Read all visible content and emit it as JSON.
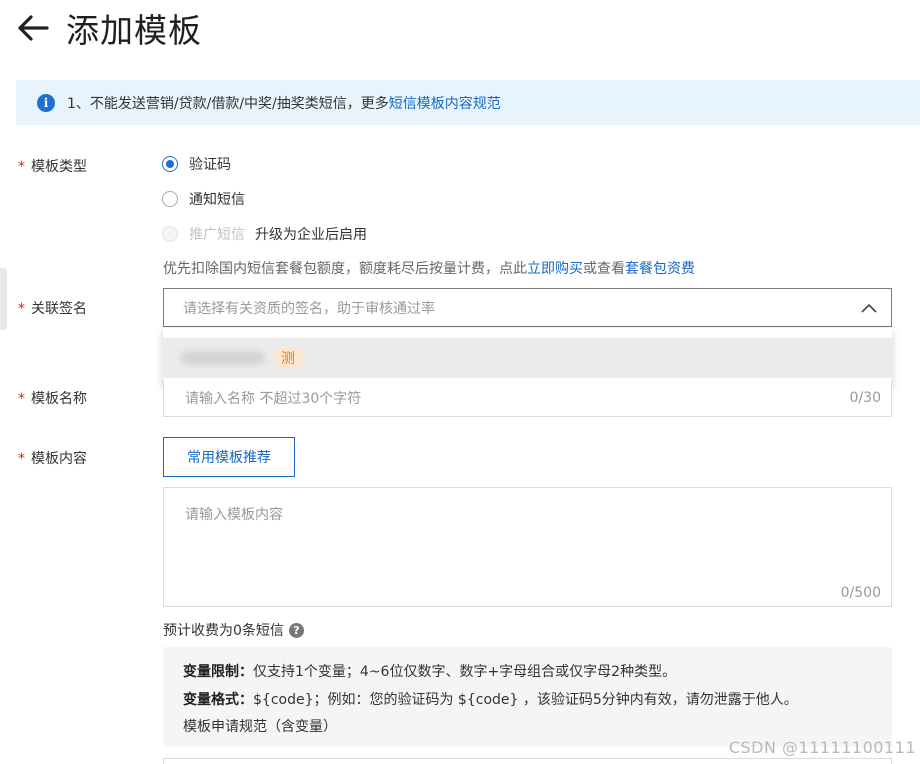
{
  "header": {
    "title": "添加模板",
    "back_icon": "arrow-left-icon"
  },
  "notice": {
    "icon": "info-icon",
    "icon_glyph": "i",
    "text": "1、不能发送营销/贷款/借款/中奖/抽奖类短信，更多",
    "link": "短信模板内容规范"
  },
  "form": {
    "template_type": {
      "label": "模板类型",
      "options": [
        {
          "label": "验证码",
          "checked": true,
          "disabled": false
        },
        {
          "label": "通知短信",
          "checked": false,
          "disabled": false
        },
        {
          "label": "推广短信",
          "checked": false,
          "disabled": true,
          "note": "升级为企业后启用"
        }
      ],
      "hint_prefix": "优先扣除国内短信套餐包额度，额度耗尽后按量计费，点此",
      "hint_link1": "立即购买",
      "hint_mid": "或查看",
      "hint_link2": "套餐包资费"
    },
    "signature": {
      "label": "关联签名",
      "placeholder": "请选择有关资质的签名，助于审核通过率",
      "dropdown_option_tag": "测"
    },
    "template_name": {
      "label": "模板名称",
      "placeholder": "请输入名称 不超过30个字符",
      "counter": "0/30"
    },
    "template_content": {
      "label": "模板内容",
      "recommend_button": "常用模板推荐",
      "placeholder": "请输入模板内容",
      "counter": "0/500"
    },
    "fee": {
      "text": "预计收费为0条短信",
      "help_glyph": "?"
    },
    "rules": {
      "limit_title": "变量限制：",
      "limit_text": "仅支持1个变量；4~6位仅数字、数字+字母组合或仅字母2种类型。",
      "format_title": "变量格式：",
      "format_text": "${code}；例如：您的验证码为 ${code} ，该验证码5分钟内有效，请勿泄露于他人。",
      "link": "模板申请规范（含变量）"
    }
  },
  "watermark": "CSDN @11111100111",
  "colors": {
    "primary": "#1868c6",
    "required": "#e2231a",
    "notice_bg": "#e8f4fd",
    "tag_bg": "#fde6cf",
    "tag_text": "#e07a1e"
  }
}
